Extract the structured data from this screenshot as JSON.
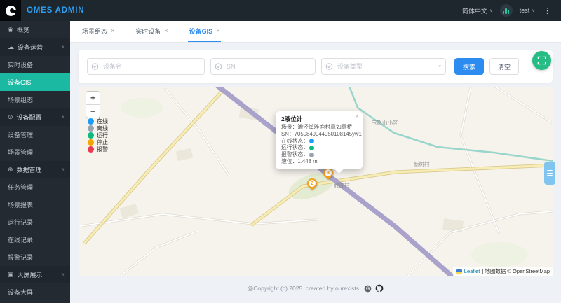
{
  "header": {
    "logo_text": "OMES ADMIN",
    "language": "简体中文",
    "username": "test"
  },
  "icons": {
    "caret_down": "∨",
    "collapse_up": "∧",
    "more_vertical": "⋮",
    "close": "×",
    "select_caret": "▾"
  },
  "sidebar": {
    "items": [
      {
        "label": "概览",
        "icon": "◉"
      },
      {
        "label": "设备运营",
        "icon": "☁"
      },
      {
        "label": "实时设备"
      },
      {
        "label": "设备GIS"
      },
      {
        "label": "场景组态"
      },
      {
        "label": "设备配置",
        "icon": "⊙"
      },
      {
        "label": "设备管理"
      },
      {
        "label": "场景管理"
      },
      {
        "label": "数据管理",
        "icon": "⊕"
      },
      {
        "label": "任务管理"
      },
      {
        "label": "场景报表"
      },
      {
        "label": "运行记录"
      },
      {
        "label": "在线记录"
      },
      {
        "label": "报警记录"
      },
      {
        "label": "大屏展示",
        "icon": "▣"
      },
      {
        "label": "设备大屏"
      }
    ]
  },
  "tabs": [
    {
      "label": "场景组态"
    },
    {
      "label": "实时设备"
    },
    {
      "label": "设备GIS"
    }
  ],
  "search": {
    "device_name_placeholder": "设备名",
    "sn_placeholder": "SN",
    "device_type_placeholder": "设备类型",
    "search_label": "搜索",
    "clear_label": "清空"
  },
  "map": {
    "zoom_in": "+",
    "zoom_out": "−",
    "legend": [
      {
        "label": "在线",
        "color": "#1e9cf5"
      },
      {
        "label": "离线",
        "color": "#99a3b0"
      },
      {
        "label": "运行",
        "color": "#0db97d"
      },
      {
        "label": "停止",
        "color": "#f7a300"
      },
      {
        "label": "报警",
        "color": "#e93a52"
      }
    ],
    "place_labels": [
      {
        "text": "玉影山小区"
      },
      {
        "text": "新树村"
      },
      {
        "text": "雅鹿村"
      }
    ],
    "markers": [
      {
        "count": "3"
      },
      {
        "count": "2"
      }
    ],
    "popup": {
      "title": "2液位计",
      "rows": [
        {
          "label": "场景：",
          "value": "漕泾镇雅鹿村靠如意桥"
        },
        {
          "label": "SN：",
          "value": "7050849044050108145yw1"
        },
        {
          "label": "在线状态：",
          "dot": "#1e9cf5"
        },
        {
          "label": "运行状态：",
          "dot": "#0db97d"
        },
        {
          "label": "报警状态：",
          "dot": "#99a3b0"
        },
        {
          "label": "液位：",
          "value": "1.448 ml"
        }
      ]
    },
    "attribution": {
      "leaflet": "Leaflet",
      "rest": " | 地图数据 © OpenStreetMap"
    }
  },
  "footer": {
    "text": "@Copyright (c) 2025. created by ourexists."
  },
  "colors": {
    "accent_blue": "#2d8cf0",
    "active_teal": "#1cb9a2",
    "fab_green": "#26bc86",
    "drawer_blue": "#7fc5ef"
  }
}
